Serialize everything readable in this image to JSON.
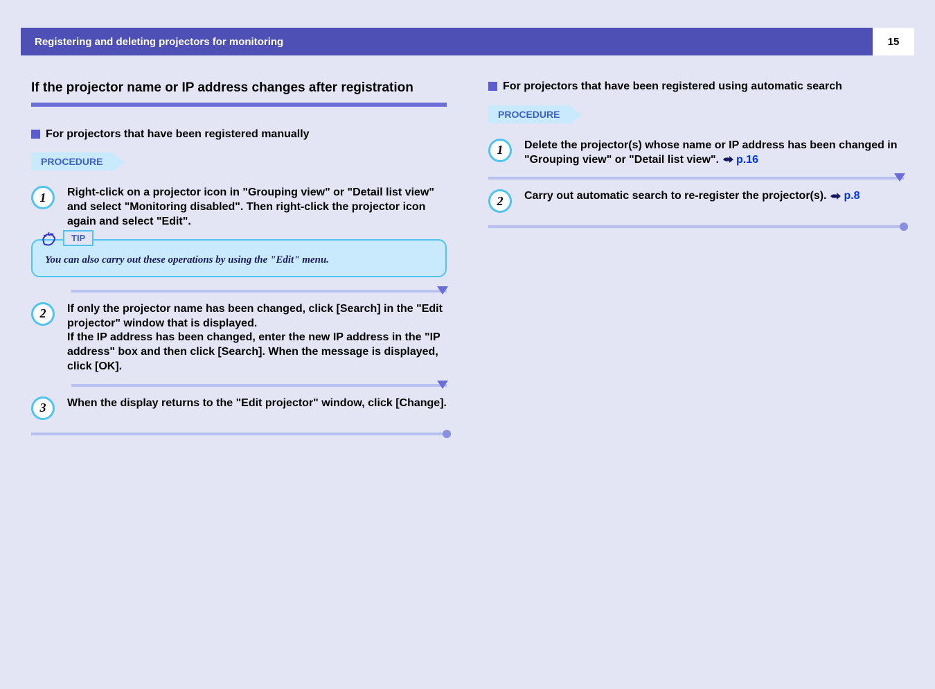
{
  "header": {
    "title": "Registering and deleting projectors for monitoring",
    "page_number": "15"
  },
  "left": {
    "section_title": "If the projector name or IP address changes after registration",
    "subsection_title": "For projectors that have been registered manually",
    "procedure_label": "PROCEDURE",
    "steps": [
      {
        "num": "1",
        "text": "Right-click on a projector icon in \"Grouping view\" or \"Detail list view\" and select \"Monitoring disabled\". Then right-click the projector icon again and select \"Edit\"."
      },
      {
        "num": "2",
        "text": "If only the projector name has been changed, click [Search] in the \"Edit projector\" window that is displayed.\nIf the IP address has been changed, enter the new IP address in the \"IP address\" box and then click [Search]. When the message is displayed, click [OK]."
      },
      {
        "num": "3",
        "text": "When the display returns to the \"Edit projector\" window, click [Change]."
      }
    ],
    "tip": {
      "label": "TIP",
      "text": "You can also carry out these operations by using the \"Edit\" menu."
    }
  },
  "right": {
    "subsection_title": "For projectors that have been registered using automatic search",
    "procedure_label": "PROCEDURE",
    "steps": [
      {
        "num": "1",
        "text_before": "Delete the projector(s) whose name or IP address has been changed in \"Grouping view\" or \"Detail list view\". ",
        "link": "p.16"
      },
      {
        "num": "2",
        "text_before": "Carry out automatic search to re-register the projector(s). ",
        "link": "p.8"
      }
    ]
  }
}
